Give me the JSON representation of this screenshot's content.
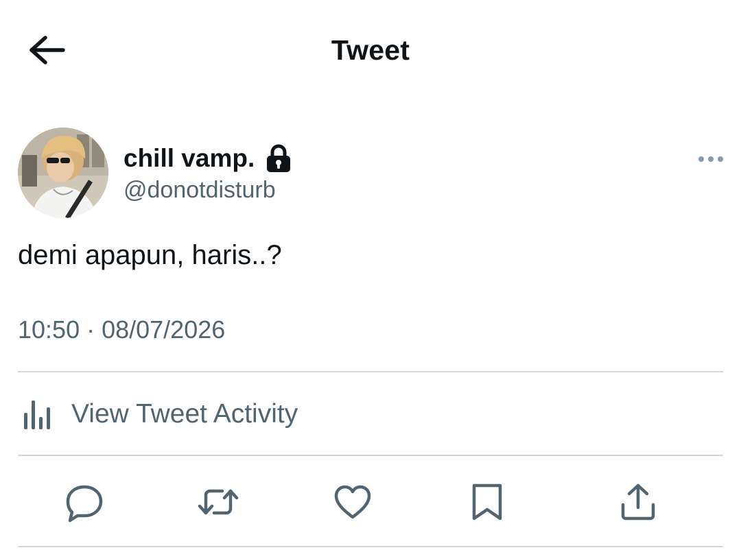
{
  "header": {
    "title": "Tweet",
    "back_icon": "arrow-left-icon"
  },
  "tweet": {
    "author": {
      "display_name": "chill vamp.",
      "handle": "@donotdisturb",
      "protected_icon": "lock-icon"
    },
    "text": "demi apapun, haris..?",
    "time": "10:50",
    "separator": "·",
    "date": "08/07/2026"
  },
  "activity": {
    "label": "View Tweet Activity",
    "icon": "analytics-bar-icon"
  },
  "actions": [
    {
      "name": "reply",
      "icon": "reply-bubble-icon"
    },
    {
      "name": "retweet",
      "icon": "retweet-icon"
    },
    {
      "name": "like",
      "icon": "heart-icon"
    },
    {
      "name": "bookmark",
      "icon": "bookmark-icon"
    },
    {
      "name": "share",
      "icon": "share-icon"
    }
  ],
  "colors": {
    "text_primary": "#0f1419",
    "text_secondary": "#536471",
    "divider": "#cfd9de",
    "background": "#ffffff"
  }
}
